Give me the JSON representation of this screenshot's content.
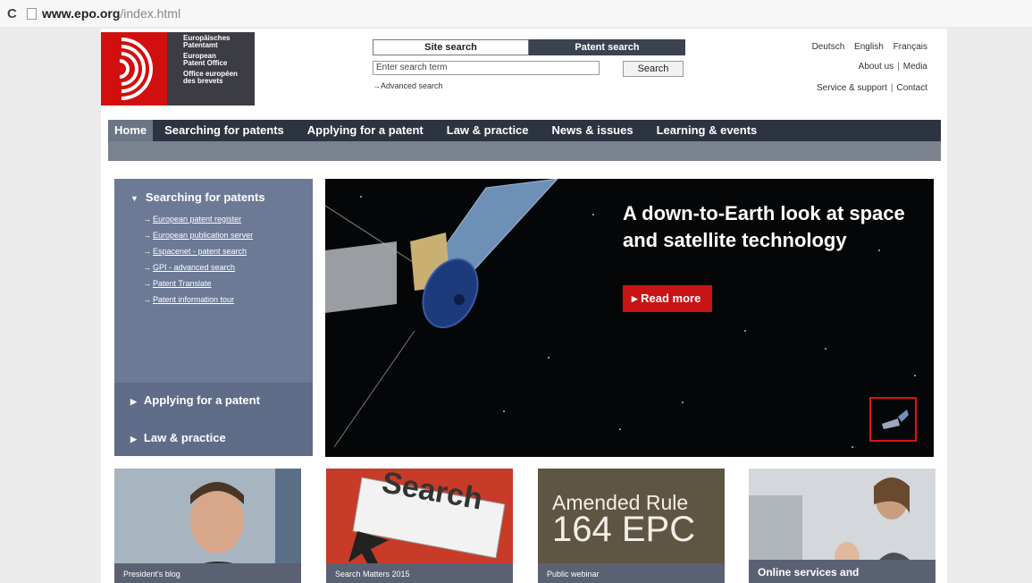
{
  "browser": {
    "url_host": "www.epo.org",
    "url_path": "/index.html"
  },
  "header": {
    "logo_lines": [
      "Europäisches",
      "Patentamt",
      "European",
      "Patent Office",
      "Office européen",
      "des brevets"
    ],
    "search_tabs": [
      "Site search",
      "Patent search"
    ],
    "search_placeholder": "Enter search term",
    "search_button": "Search",
    "advanced_search": "Advanced search",
    "languages": [
      "Deutsch",
      "English",
      "Français"
    ],
    "about_links": [
      "About us",
      "Media"
    ],
    "support_links": [
      "Service & support",
      "Contact"
    ]
  },
  "main_nav": {
    "items": [
      "Home",
      "Searching for patents",
      "Applying for a patent",
      "Law & practice",
      "News & issues",
      "Learning & events"
    ]
  },
  "sidebar": {
    "section_title": "Searching for patents",
    "links": [
      "European patent register",
      "European publication server",
      "Espacenet - patent search",
      "GPI - advanced search",
      "Patent Translate",
      "Patent information tour"
    ],
    "collapsed_sections": [
      "Applying for a patent",
      "Law & practice"
    ]
  },
  "hero": {
    "headline": "A down-to-Earth look at space and satellite technology",
    "cta": "Read more"
  },
  "teasers": [
    {
      "caption": "President's blog"
    },
    {
      "caption": "Search Matters 2015",
      "image_text": "Search"
    },
    {
      "caption": "Public webinar",
      "image_line1": "Amended Rule",
      "image_line2": "164 EPC"
    },
    {
      "caption": "Online services and"
    }
  ],
  "colors": {
    "brand_red": "#d10f0f",
    "nav_dark": "#2d3441",
    "sidebar": "#6c7a96"
  }
}
